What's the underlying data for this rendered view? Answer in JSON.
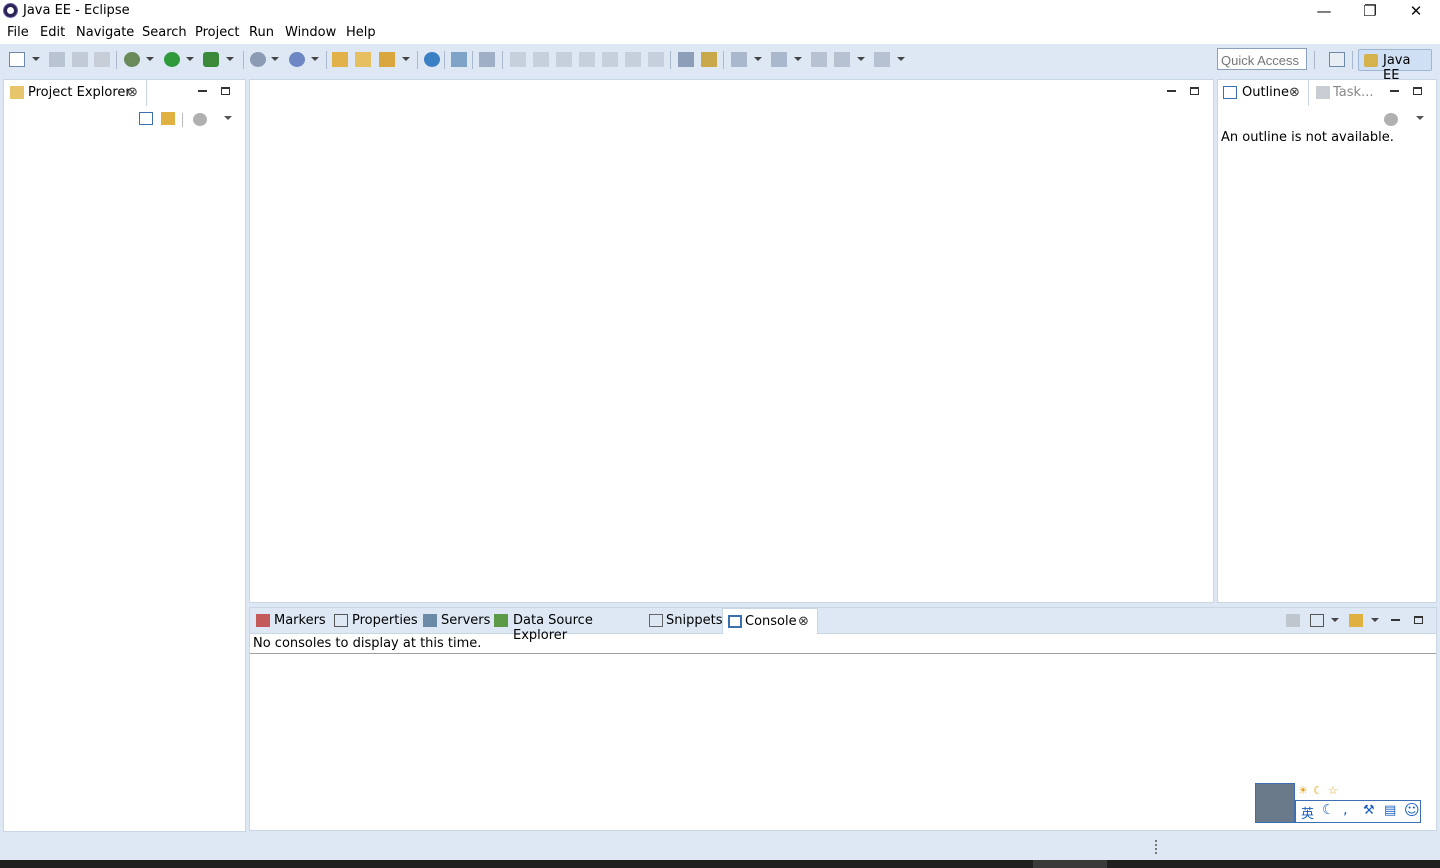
{
  "window": {
    "title": "Java EE - Eclipse",
    "icon": "eclipse-icon",
    "controls": [
      "minimize-icon",
      "restore-icon",
      "close-icon"
    ]
  },
  "menu": [
    "File",
    "Edit",
    "Navigate",
    "Search",
    "Project",
    "Run",
    "Window",
    "Help"
  ],
  "toolbar": {
    "quick_access": "Quick Access",
    "perspective": "Java EE"
  },
  "project_explorer": {
    "tab_label": "Project Explorer"
  },
  "outline": {
    "tab_label": "Outline",
    "task_tab_label": "Task...",
    "message": "An outline is not available."
  },
  "bottom": {
    "tabs": [
      "Markers",
      "Properties",
      "Servers",
      "Data Source Explorer",
      "Snippets",
      "Console"
    ],
    "active_tab": "Console",
    "message": "No consoles to display at this time."
  },
  "ime": {
    "mode": "英"
  },
  "colors": {
    "chrome": "#dde8f4",
    "panel_border": "#c9d6e6",
    "taskbar": "#1f1f1f"
  }
}
